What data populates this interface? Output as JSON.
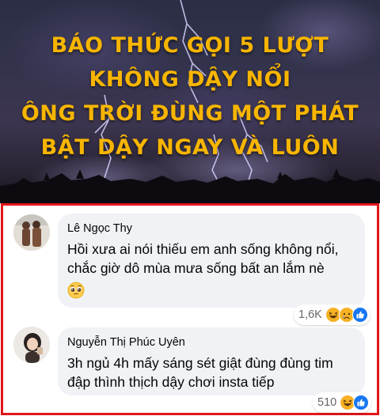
{
  "banner": {
    "lines": [
      "BÁO THỨC GỌI 5 LƯỢT",
      "KHÔNG DẬY NỔI",
      "ÔNG TRỜI ĐÙNG MỘT PHÁT",
      "BẬT DẬY NGAY VÀ LUÔN"
    ],
    "text_color": "#f7b500"
  },
  "comments": [
    {
      "author": "Lê Ngọc Thy",
      "text": "Hồi xưa ai nói thiếu em anh sống không nổi, chắc giờ dô mùa mưa sống bất an lắm nè",
      "emoji": "pleading-face",
      "reaction_count": "1,6K",
      "reactions": [
        "haha-icon",
        "sad-icon",
        "like-icon"
      ]
    },
    {
      "author": "Nguyễn Thị Phúc Uyên",
      "text": "3h ngủ 4h mấy sáng sét giật đùng đùng tim đập thình thịch dậy chơi insta tiếp",
      "reaction_count": "510",
      "reactions": [
        "haha-icon",
        "like-icon"
      ]
    }
  ],
  "colors": {
    "frame_border": "#e3161b",
    "bubble_bg": "#f0f2f5",
    "like_blue": "#1877f2",
    "haha_yellow": "#f7b125"
  }
}
